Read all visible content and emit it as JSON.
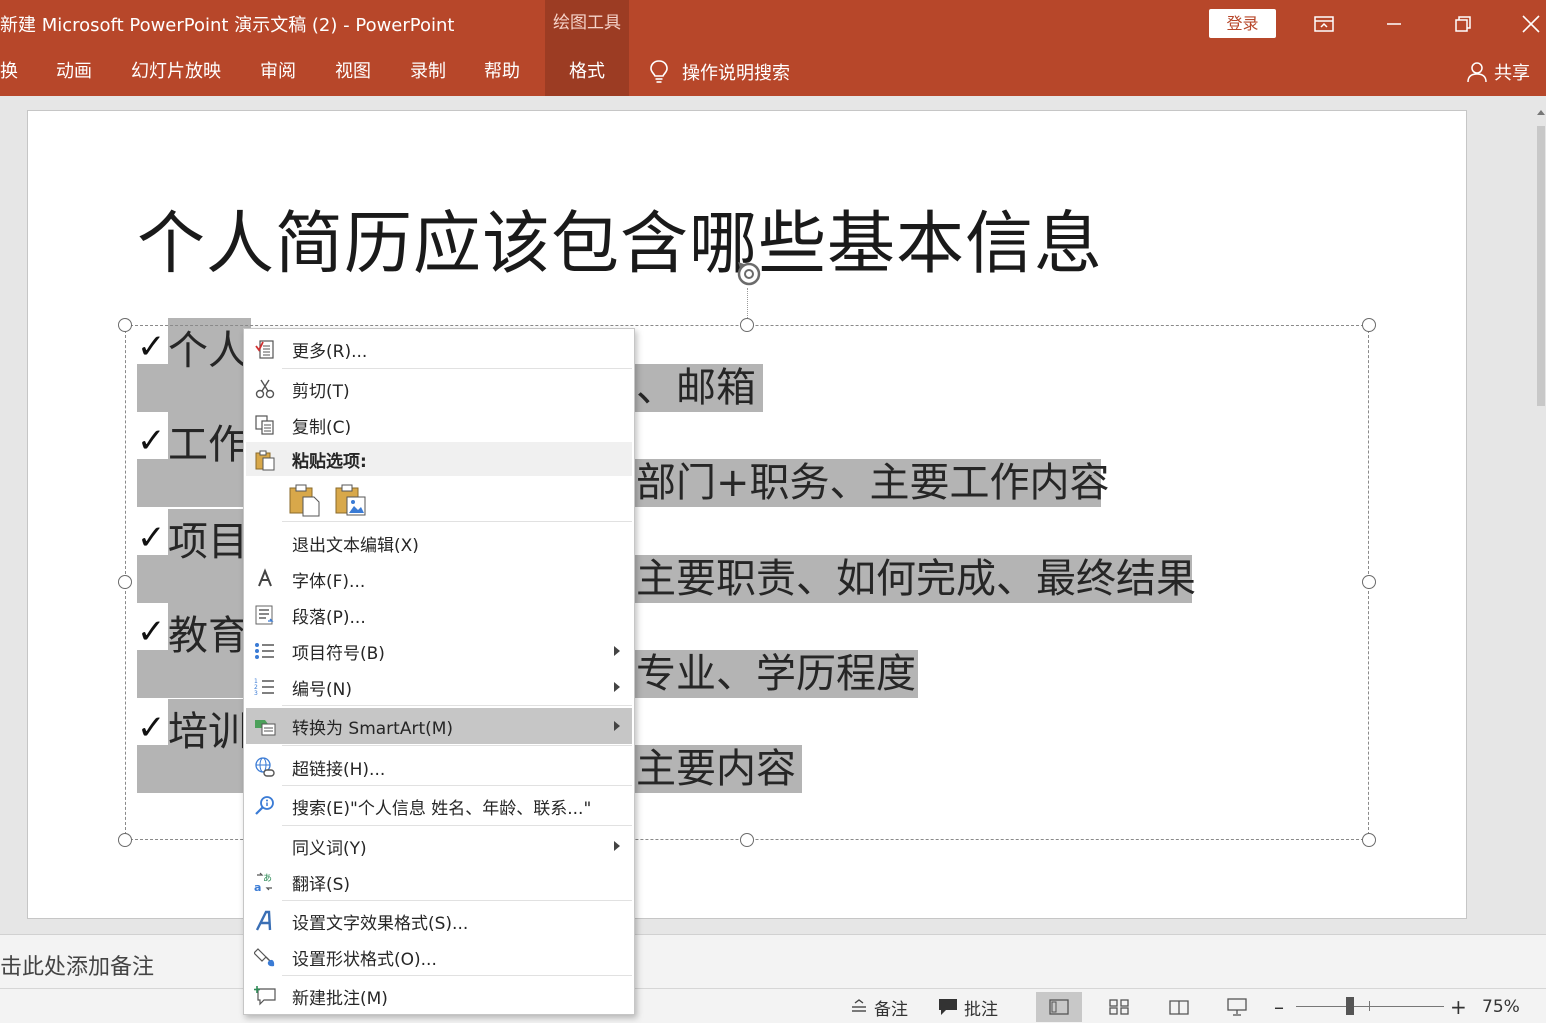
{
  "window": {
    "title": "新建 Microsoft PowerPoint 演示文稿 (2)  -  PowerPoint",
    "contextual_tab_group": "绘图工具",
    "login_label": "登录"
  },
  "ribbon": {
    "tabs": [
      "换",
      "动画",
      "幻灯片放映",
      "审阅",
      "视图",
      "录制",
      "帮助",
      "格式"
    ],
    "active_tab": "格式",
    "tell_me": "操作说明搜索",
    "share": "共享"
  },
  "slide": {
    "title": "个人简历应该包含哪些基本信息",
    "lines": [
      {
        "visible_start": "个人",
        "visible_end": "、邮箱"
      },
      {
        "visible_start": "工作",
        "visible_end": "部门+职务、主要工作内容"
      },
      {
        "visible_start": "项目",
        "visible_end": "主要职责、如何完成、最终结果"
      },
      {
        "visible_start": "教育",
        "visible_end": "专业、学历程度"
      },
      {
        "visible_start": "培训",
        "visible_end": "主要内容"
      }
    ],
    "bullet_glyph": "✓"
  },
  "notes": {
    "placeholder": "击此处添加备注"
  },
  "statusbar": {
    "notes_label": "备注",
    "comments_label": "批注",
    "zoom_percent": "75%",
    "zoom_level": 0.75
  },
  "context_menu": {
    "items": [
      {
        "label": "更多(R)...",
        "icon": "more-clipboard-icon"
      },
      {
        "label": "剪切(T)",
        "icon": "scissors-icon"
      },
      {
        "label": "复制(C)",
        "icon": "copy-icon"
      },
      {
        "label": "粘贴选项:",
        "icon": "paste-icon",
        "header": true
      },
      {
        "label": "退出文本编辑(X)"
      },
      {
        "label": "字体(F)...",
        "icon": "font-icon"
      },
      {
        "label": "段落(P)...",
        "icon": "paragraph-icon"
      },
      {
        "label": "项目符号(B)",
        "icon": "bullets-icon",
        "submenu": true
      },
      {
        "label": "编号(N)",
        "icon": "numbering-icon",
        "submenu": true
      },
      {
        "label": "转换为 SmartArt(M)",
        "icon": "smartart-icon",
        "submenu": true,
        "highlighted": true
      },
      {
        "label": "超链接(H)...",
        "icon": "hyperlink-icon"
      },
      {
        "label": "搜索(E)\"个人信息 姓名、年龄、联系...\"",
        "icon": "search-icon"
      },
      {
        "label": "同义词(Y)",
        "submenu": true
      },
      {
        "label": "翻译(S)",
        "icon": "translate-icon"
      },
      {
        "label": "设置文字效果格式(S)...",
        "icon": "text-effects-icon"
      },
      {
        "label": "设置形状格式(O)...",
        "icon": "shape-format-icon"
      },
      {
        "label": "新建批注(M)",
        "icon": "new-comment-icon"
      }
    ]
  },
  "colors": {
    "accent": "#b7472a",
    "accent_dark": "#9c3c23",
    "highlight_gray": "#b4b4b4",
    "menu_hover": "#c6c6c6"
  }
}
